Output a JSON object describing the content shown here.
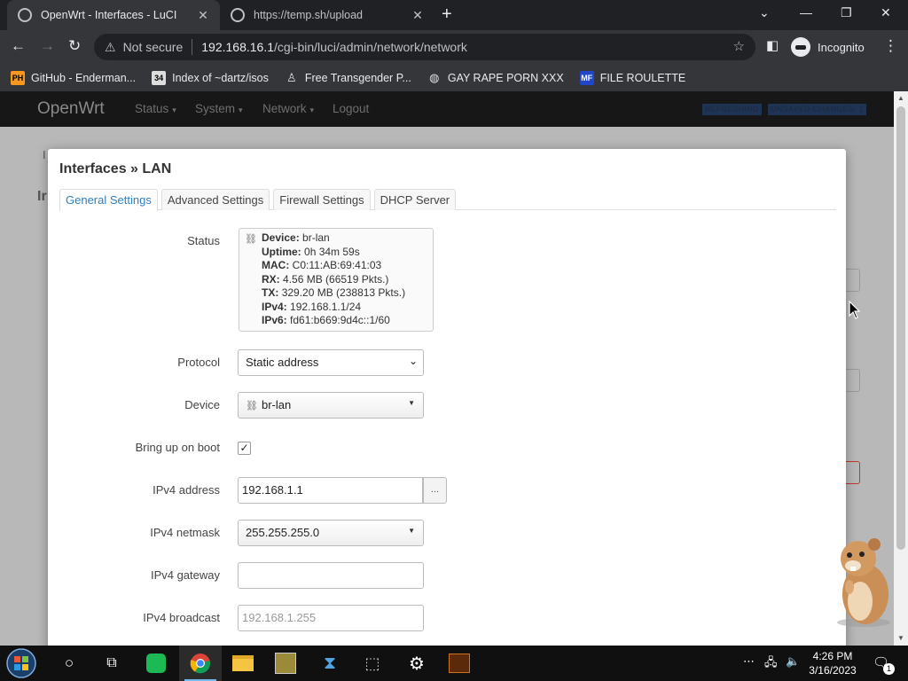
{
  "browser": {
    "tabs": [
      {
        "title": "OpenWrt - Interfaces - LuCI",
        "active": true
      },
      {
        "title": "https://temp.sh/upload",
        "active": false
      }
    ],
    "security_label": "Not secure",
    "url_host": "192.168.16.1",
    "url_path": "/cgi-bin/luci/admin/network/network",
    "profile_label": "Incognito",
    "bookmarks": [
      {
        "label": "GitHub - Enderman...",
        "icon": "PH"
      },
      {
        "label": "Index of ~dartz/isos",
        "icon": "34"
      },
      {
        "label": "Free Transgender P...",
        "icon": "user-icon"
      },
      {
        "label": "GAY RAPE PORN XXX",
        "icon": "globe-icon"
      },
      {
        "label": "FILE ROULETTE",
        "icon": "MF"
      }
    ]
  },
  "luci": {
    "brand": "OpenWrt",
    "nav": [
      "Status",
      "System",
      "Network",
      "Logout"
    ],
    "badges": [
      "REFRESHING",
      "UNSAVED CHANGES: 1"
    ]
  },
  "modal": {
    "title": "Interfaces » LAN",
    "tabs": [
      "General Settings",
      "Advanced Settings",
      "Firewall Settings",
      "DHCP Server"
    ],
    "status_label": "Status",
    "status": {
      "device_key": "Device:",
      "device": "br-lan",
      "uptime_key": "Uptime:",
      "uptime": "0h 34m 59s",
      "mac_key": "MAC:",
      "mac": "C0:11:AB:69:41:03",
      "rx_key": "RX:",
      "rx": "4.56 MB (66519 Pkts.)",
      "tx_key": "TX:",
      "tx": "329.20 MB (238813 Pkts.)",
      "ipv4_key": "IPv4:",
      "ipv4": "192.168.1.1/24",
      "ipv6_key": "IPv6:",
      "ipv6": "fd61:b669:9d4c::1/60"
    },
    "protocol_label": "Protocol",
    "protocol_value": "Static address",
    "device_label": "Device",
    "device_value": "br-lan",
    "boot_label": "Bring up on boot",
    "boot_checked": "✓",
    "ipv4_address_label": "IPv4 address",
    "ipv4_address_value": "192.168.1.1",
    "ipv4_address_more": "...",
    "netmask_label": "IPv4 netmask",
    "netmask_value": "255.255.255.0",
    "gateway_label": "IPv4 gateway",
    "gateway_value": "",
    "broadcast_label": "IPv4 broadcast",
    "broadcast_placeholder": "192.168.1.255"
  },
  "taskbar": {
    "time": "4:26 PM",
    "date": "3/16/2023",
    "notification_count": "1"
  }
}
